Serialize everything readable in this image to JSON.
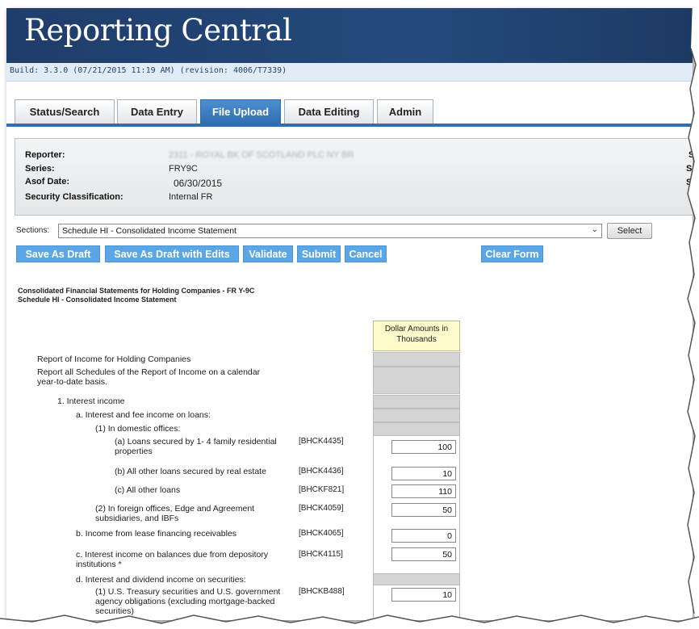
{
  "app": {
    "title": "Reporting Central",
    "build": "Build: 3.3.0 (07/21/2015 11:19 AM) (revision: 4006/T7339)"
  },
  "tabs": [
    {
      "label": "Status/Search",
      "active": false
    },
    {
      "label": "Data Entry",
      "active": false
    },
    {
      "label": "File Upload",
      "active": true
    },
    {
      "label": "Data Editing",
      "active": false
    },
    {
      "label": "Admin",
      "active": false
    }
  ],
  "info": {
    "reporter_label": "Reporter:",
    "reporter_value": "2311 - ROYAL BK OF SCOTLAND PLC NY BR",
    "series_label": "Series:",
    "series_value": "FRY9C",
    "asof_label": "Asof Date:",
    "asof_value": "06/30/2015",
    "security_label": "Security Classification:",
    "security_value": "Internal FR",
    "right_labels": [
      "St",
      "Su",
      "Su"
    ]
  },
  "sections": {
    "label": "Sections:",
    "selected": "Schedule HI - Consolidated Income Statement",
    "select_button": "Select"
  },
  "actions": {
    "save_draft": "Save As Draft",
    "save_draft_edits": "Save As Draft with Edits",
    "validate": "Validate",
    "submit": "Submit",
    "cancel": "Cancel",
    "clear_form": "Clear Form"
  },
  "form": {
    "heading1": "Consolidated Financial Statements for Holding Companies - FR Y-9C",
    "heading2": "Schedule HI - Consolidated Income Statement",
    "column_header": "Dollar Amounts in Thousands",
    "rows": [
      {
        "label": "Report of Income for Holding Companies"
      },
      {
        "label": "Report all Schedules of the Report of Income on a calendar year-to-date basis."
      },
      {
        "label": "1. Interest income"
      },
      {
        "label": "a. Interest and fee income on loans:"
      },
      {
        "label": "(1) In domestic offices:"
      },
      {
        "label": "(a) Loans secured by 1- 4 family residential properties",
        "code": "[BHCK4435]",
        "value": "100"
      },
      {
        "label": "(b) All other loans secured by real estate",
        "code": "[BHCK4436]",
        "value": "10"
      },
      {
        "label": "(c) All other loans",
        "code": "[BHCKF821]",
        "value": "110"
      },
      {
        "label": "(2) In foreign offices, Edge and Agreement subsidiaries, and IBFs",
        "code": "[BHCK4059]",
        "value": "50"
      },
      {
        "label": "b. Income from lease financing receivables",
        "code": "[BHCK4065]",
        "value": "0"
      },
      {
        "label": "c. Interest income on balances due from depository institutions *",
        "code": "[BHCK4115]",
        "value": "50"
      },
      {
        "label": "d. Interest and dividend income on securities:"
      },
      {
        "label": "(1) U.S. Treasury securities and U.S. government agency obligations (excluding mortgage-backed securities)",
        "code": "[BHCKB488]",
        "value": "10"
      }
    ]
  }
}
